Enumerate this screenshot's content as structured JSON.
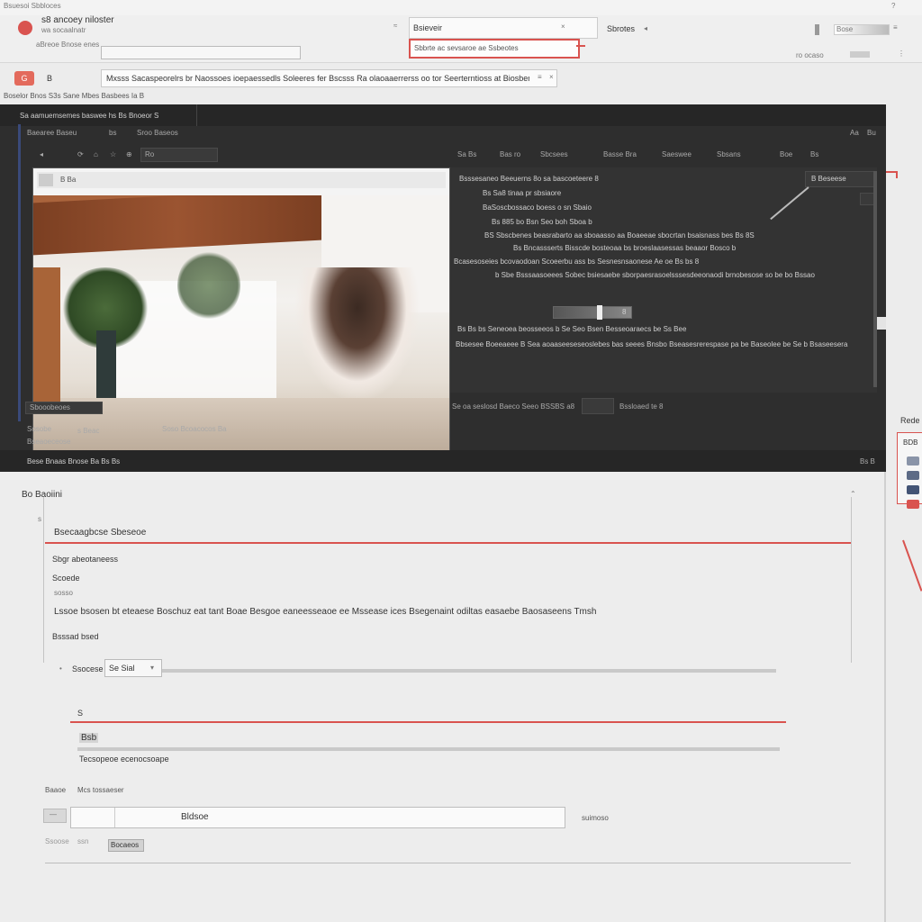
{
  "browser": {
    "tab_label": "Bsuesoi Sbbloces",
    "app_title": "s8 ancoey niloster",
    "app_subtitle": "wa socaalnatr",
    "breadcrumb_small": "aBreoe Bnose enes",
    "address_text": "Bsieveir",
    "address_suffix": "Sbrotes",
    "search_dropdown_text": "Sbbrte ac sevsaroe ae Ssbeotes",
    "right_field_text": "Bose",
    "right_hint": "ro ocaso",
    "help_hint": "?"
  },
  "toolbar": {
    "badge": "G",
    "filter_label": "B",
    "notice_text": "Mxsss  Sacaspeorelrs br Naossoes ioepaessedls Soleeres fer Bscsss Ra olaoaaerrerss oo tor Seerterntioss at Biosbene",
    "notice_menu": "≡",
    "notice_close": "×",
    "tabs_row": "Boselor  Bnos  S3s  Sane  Mbes  Basbees  Ia  B"
  },
  "editor": {
    "title": "Sa aamuemsemes baswee hs  Bs Bnoeor  S",
    "subtabs": [
      "Baearee Baseu",
      "bs",
      "Sroo  Baseos"
    ],
    "toolbar_right": [
      "Aa",
      "Bu"
    ],
    "video_toolbar_url": "Ro",
    "video_panel_tabs": [
      "Sa Bs",
      "Bas ro",
      "Sbcsees",
      "Basse Bra",
      "Saeswee",
      "Sbsans",
      "Boe",
      "Bs"
    ],
    "video_title_tag": "B  Ba",
    "right_panel_badge": "B Beseese",
    "right_lines": [
      "Bsssesaneo Beeuerns 8o sa bascoeteere 8",
      "Bs Sa8 tinaa pr sbsiaore",
      "BaSoscbossaco boess o sn Sbaio",
      "Bs 885 bo Bsn Seo boh Sboa b",
      "BS Sbscbenes beasrabarto aa sboaasso aa Boaeeae sbocrtan bsaisnass bes Bs 8S",
      "Bs Bncassserts Bisscde bosteoaa bs broeslaasessas beaaor Bosco b",
      "Bcasesoseies bcovaodoan Scoeerbu ass bs Sesnesnsaonese Ae oe Bs bs 8",
      "b  Sbe Bsssaasoeees Sobec bsiesaebe sborpaesrasoelsssesdeeonaodi brnobesose so be bo Bssao"
    ],
    "slider_value": "8",
    "bottom_line_1": "Bs Bs bs Seneoea beosseeos  b Se Seo  Bsen Besseoaraecs  be  Ss Bee",
    "bottom_line_2": "Bbsesee Boeeaeee  B  Sea aoaaseeseseoslebes bas seees Bnsbo Bseasesrerespase pa be Baseolee be Se b Bsaseesera",
    "footer_mid": "Se oa seslosd  Baeco  Seeo  BSSBS  a8",
    "footer_right": "Bssloaed te  8",
    "left_status": [
      "Sbooobeoes",
      "Sosobe",
      "s Beac",
      "Soso  Bcoacocos  Ba"
    ],
    "left_status_2": "Bseaoeceose",
    "bottom_bar": "Bese Bnaas Bnose  Ba  Bs  Bs",
    "bottom_bar_right": "Bs  B"
  },
  "rightrail": {
    "label": "Rede",
    "sub": "BDB"
  },
  "form": {
    "section_title": "Bo Baoiini",
    "section_marker": "s",
    "heading": "Bsecaagbcse Sbeseoe",
    "subheading": "Sbgr abeotaneess",
    "field_label": "Scoede",
    "field_hint": "sosso",
    "description": "Lssoe bsosen bt eteaese  Boschuz eat tant Boae  Besgoe eaneesseaoe  ee  Mssease ices  Bsegenaint odiltas  easaebe  Baosaseens  Tmsh",
    "settings_label": "Bsssad bsed",
    "slider_label": "Ssocese",
    "slider_value": "Se Sial",
    "slider_unit": "se",
    "row2_label": "S",
    "row3_label": "Bsb",
    "row3_sub": "Tecsopeoe ecenocsoape",
    "footer_label_1": "Baaoe",
    "footer_label_2": "Mcs tossaeser",
    "input_prefix": "—",
    "input_value": "Bldsoe",
    "input_suffix": "suimoso",
    "status_1": "Ssoose",
    "status_2": "ssn",
    "status_button": "Bocaeos"
  },
  "colors": {
    "accent_red": "#d9534f",
    "editor_bg": "#2e2e2e",
    "page_bg": "#ececec"
  }
}
